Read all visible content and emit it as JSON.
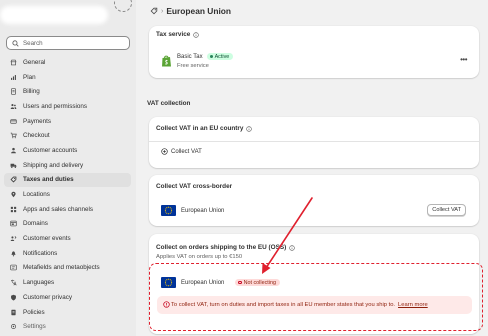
{
  "sidebar": {
    "search_placeholder": "Search",
    "items": [
      {
        "label": "General",
        "icon": "store-icon"
      },
      {
        "label": "Plan",
        "icon": "plan-icon"
      },
      {
        "label": "Billing",
        "icon": "billing-icon"
      },
      {
        "label": "Users and permissions",
        "icon": "users-icon"
      },
      {
        "label": "Payments",
        "icon": "payments-icon"
      },
      {
        "label": "Checkout",
        "icon": "checkout-icon"
      },
      {
        "label": "Customer accounts",
        "icon": "customer-icon"
      },
      {
        "label": "Shipping and delivery",
        "icon": "truck-icon"
      },
      {
        "label": "Taxes and duties",
        "icon": "tax-icon",
        "selected": true
      },
      {
        "label": "Locations",
        "icon": "location-icon"
      },
      {
        "label": "Apps and sales channels",
        "icon": "apps-icon"
      },
      {
        "label": "Domains",
        "icon": "globe-icon"
      },
      {
        "label": "Customer events",
        "icon": "events-icon"
      },
      {
        "label": "Notifications",
        "icon": "bell-icon"
      },
      {
        "label": "Metafields and metaobjects",
        "icon": "metafields-icon"
      },
      {
        "label": "Languages",
        "icon": "language-icon"
      },
      {
        "label": "Customer privacy",
        "icon": "privacy-icon"
      },
      {
        "label": "Policies",
        "icon": "policies-icon"
      },
      {
        "label": "Settings",
        "icon": "settings-icon"
      }
    ]
  },
  "breadcrumb": {
    "icon": "tax-icon",
    "title": "European Union"
  },
  "tax_service": {
    "title": "Tax service",
    "app_name": "Basic Tax",
    "status": "Active",
    "subtitle": "Free service"
  },
  "vat_collection_heading": "VAT collection",
  "eu_country_card": {
    "title": "Collect VAT in an EU country",
    "action": "Collect VAT"
  },
  "cross_border_card": {
    "title": "Collect VAT cross-border",
    "country": "European Union",
    "button": "Collect VAT"
  },
  "oss_card": {
    "title": "Collect on orders shipping to the EU (OSS)",
    "subtitle": "Applies VAT on orders up to €150",
    "country": "European Union",
    "status": "Not collecting",
    "alert_text": "To collect VAT, turn on duties and import taxes in all EU member states that you ship to.",
    "alert_link": "Learn more"
  },
  "colors": {
    "accent_red": "#e0202e",
    "active_badge_bg": "#cdfee1",
    "critical_badge_bg": "#fedad9",
    "eu_blue": "#003399"
  }
}
